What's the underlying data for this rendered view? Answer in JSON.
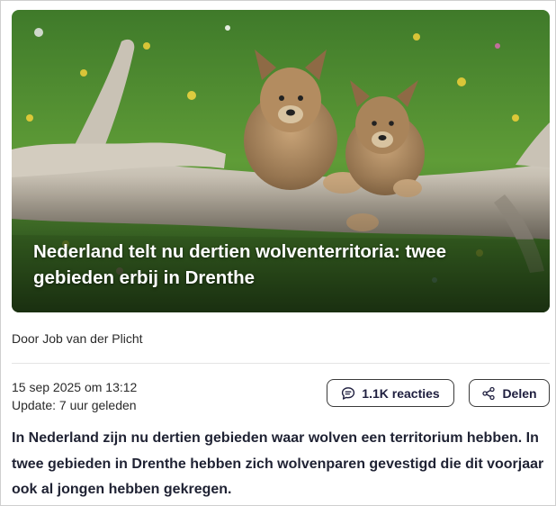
{
  "article": {
    "headline": "Nederland telt nu dertien wolventerritoria: twee gebieden erbij in Drenthe",
    "byline": "Door Job van der Plicht",
    "published": "15 sep 2025 om 13:12",
    "updated": "Update: 7 uur geleden",
    "lead": "In Nederland zijn nu dertien gebieden waar wolven een territorium hebben. In twee gebieden in Drenthe hebben zich wolvenparen gevestigd die dit voorjaar ook al jongen hebben gekregen."
  },
  "actions": {
    "comments_label": "1.1K reacties",
    "comments_icon": "speech-bubble-icon",
    "share_label": "Delen",
    "share_icon": "share-icon"
  },
  "colors": {
    "text": "#1f2233",
    "button_border": "#3a3a3a",
    "headline_text": "#ffffff"
  }
}
